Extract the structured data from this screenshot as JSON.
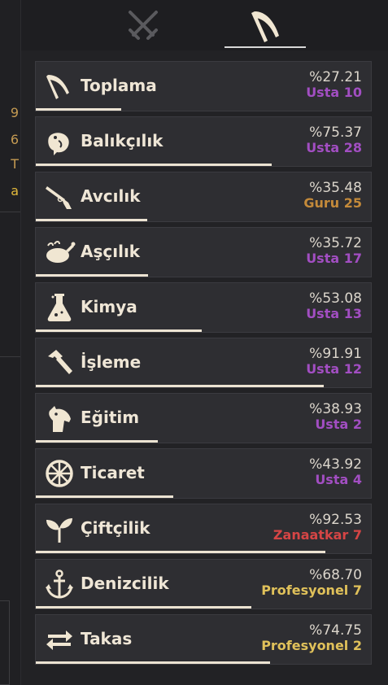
{
  "colors": {
    "usta": "#a24ec2",
    "guru": "#c48a3a",
    "zanaatkar": "#d64545",
    "profesyonel": "#e0c15a",
    "bar": "#ece3d2"
  },
  "left_strip": [
    {
      "text": "9",
      "color": "#c49a52"
    },
    {
      "text": "6",
      "color": "#c49a52"
    },
    {
      "text": "T",
      "color": "#c49a52"
    },
    {
      "text": "a",
      "color": "#e2b93b"
    }
  ],
  "tabs": [
    {
      "icon": "crossed-swords-icon",
      "active": false
    },
    {
      "icon": "scythe-icon",
      "active": true
    }
  ],
  "skills": [
    {
      "icon": "scythe-icon",
      "name": "Toplama",
      "percent": "%27.21",
      "rank": "Usta",
      "level": "10",
      "rank_type": "usta",
      "progress": 0.2721
    },
    {
      "icon": "fish-icon",
      "name": "Balıkçılık",
      "percent": "%75.37",
      "rank": "Usta",
      "level": "28",
      "rank_type": "usta",
      "progress": 0.7537
    },
    {
      "icon": "rifle-icon",
      "name": "Avcılık",
      "percent": "%35.48",
      "rank": "Guru",
      "level": "25",
      "rank_type": "guru",
      "progress": 0.3548
    },
    {
      "icon": "roast-chicken-icon",
      "name": "Aşçılık",
      "percent": "%35.72",
      "rank": "Usta",
      "level": "17",
      "rank_type": "usta",
      "progress": 0.3572
    },
    {
      "icon": "flask-icon",
      "name": "Kimya",
      "percent": "%53.08",
      "rank": "Usta",
      "level": "13",
      "rank_type": "usta",
      "progress": 0.5308
    },
    {
      "icon": "hammer-icon",
      "name": "İşleme",
      "percent": "%91.91",
      "rank": "Usta",
      "level": "12",
      "rank_type": "usta",
      "progress": 0.9191
    },
    {
      "icon": "horse-head-icon",
      "name": "Eğitim",
      "percent": "%38.93",
      "rank": "Usta",
      "level": "2",
      "rank_type": "usta",
      "progress": 0.3893
    },
    {
      "icon": "wheel-icon",
      "name": "Ticaret",
      "percent": "%43.92",
      "rank": "Usta",
      "level": "4",
      "rank_type": "usta",
      "progress": 0.4392
    },
    {
      "icon": "sprout-icon",
      "name": "Çiftçilik",
      "percent": "%92.53",
      "rank": "Zanaatkar",
      "level": "7",
      "rank_type": "zanaatkar",
      "progress": 0.9253
    },
    {
      "icon": "anchor-icon",
      "name": "Denizcilik",
      "percent": "%68.70",
      "rank": "Profesyonel",
      "level": "7",
      "rank_type": "profesyonel",
      "progress": 0.687
    },
    {
      "icon": "swap-arrows-icon",
      "name": "Takas",
      "percent": "%74.75",
      "rank": "Profesyonel",
      "level": "2",
      "rank_type": "profesyonel",
      "progress": 0.7475
    }
  ]
}
